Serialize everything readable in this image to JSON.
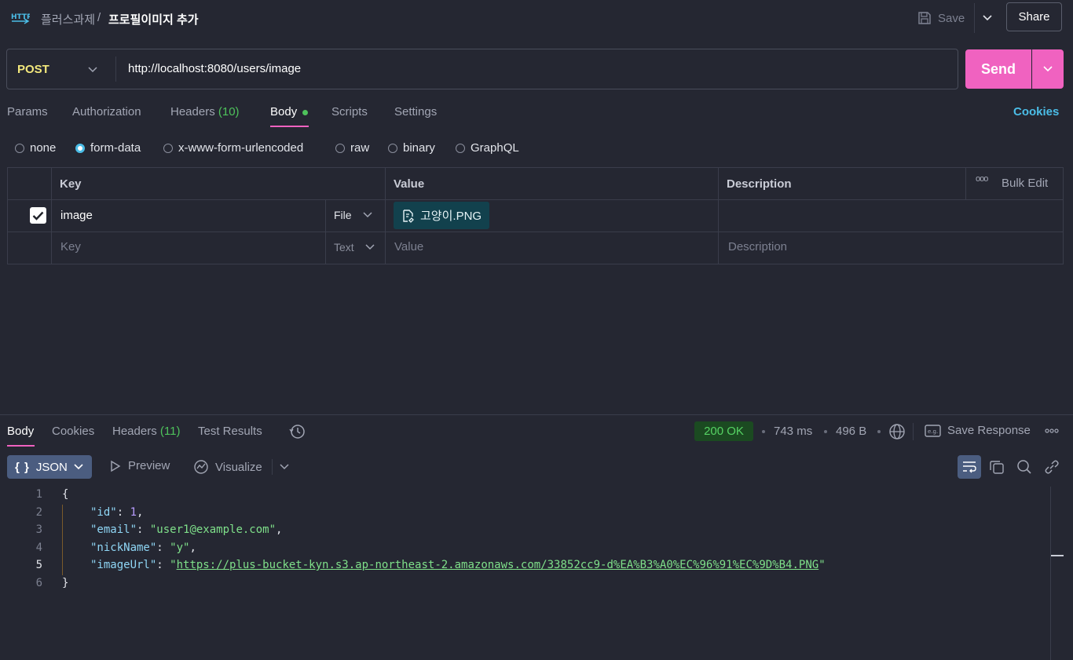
{
  "breadcrumb": {
    "parent": "플러스과제",
    "separator": "/",
    "current": "프로필이미지 추가"
  },
  "toolbar": {
    "save_label": "Save",
    "share_label": "Share"
  },
  "request": {
    "method": "POST",
    "url": "http://localhost:8080/users/image",
    "send_label": "Send"
  },
  "request_tabs": [
    {
      "label": "Params"
    },
    {
      "label": "Authorization"
    },
    {
      "label": "Headers",
      "count": "(10)"
    },
    {
      "label": "Body"
    },
    {
      "label": "Scripts"
    },
    {
      "label": "Settings"
    }
  ],
  "cookies_link": "Cookies",
  "body_types": [
    "none",
    "form-data",
    "x-www-form-urlencoded",
    "raw",
    "binary",
    "GraphQL"
  ],
  "body_type_selected": "form-data",
  "form_table": {
    "headers": {
      "key": "Key",
      "value": "Value",
      "description": "Description"
    },
    "more_label": "ooo",
    "bulk_edit": "Bulk Edit",
    "rows": [
      {
        "checked": true,
        "key": "image",
        "type": "File",
        "value": "고양이.PNG",
        "description": ""
      }
    ],
    "placeholder_row": {
      "key": "Key",
      "type": "Text",
      "value": "Value",
      "description": "Description"
    }
  },
  "response": {
    "tabs": [
      {
        "label": "Body"
      },
      {
        "label": "Cookies"
      },
      {
        "label": "Headers",
        "count": "(11)"
      },
      {
        "label": "Test Results"
      }
    ],
    "status": "200 OK",
    "time": "743 ms",
    "size": "496 B",
    "save_response": "Save Response",
    "format": "JSON",
    "format_braces": "{ }",
    "preview_label": "Preview",
    "visualize_label": "Visualize",
    "code": {
      "line_numbers": [
        "1",
        "2",
        "3",
        "4",
        "5",
        "6"
      ],
      "open_brace": "{",
      "close_brace": "}",
      "id_key": "\"id\"",
      "id_value": "1",
      "email_key": "\"email\"",
      "email_value": "\"user1@example.com\"",
      "nick_key": "\"nickName\"",
      "nick_value": "\"y\"",
      "image_key": "\"imageUrl\"",
      "image_url": "https://plus-bucket-kyn.s3.ap-northeast-2.amazonaws.com/33852cc9-d%EA%B3%A0%EC%96%91%EC%9D%B4.PNG"
    }
  },
  "colors": {
    "background": "#252732",
    "send": "#f062c0",
    "method": "#f3e87c",
    "accent_link": "#4bbde7",
    "count_green": "#4ec25b",
    "status_ok_bg": "#1b4a21",
    "file_chip": "#12414d"
  }
}
